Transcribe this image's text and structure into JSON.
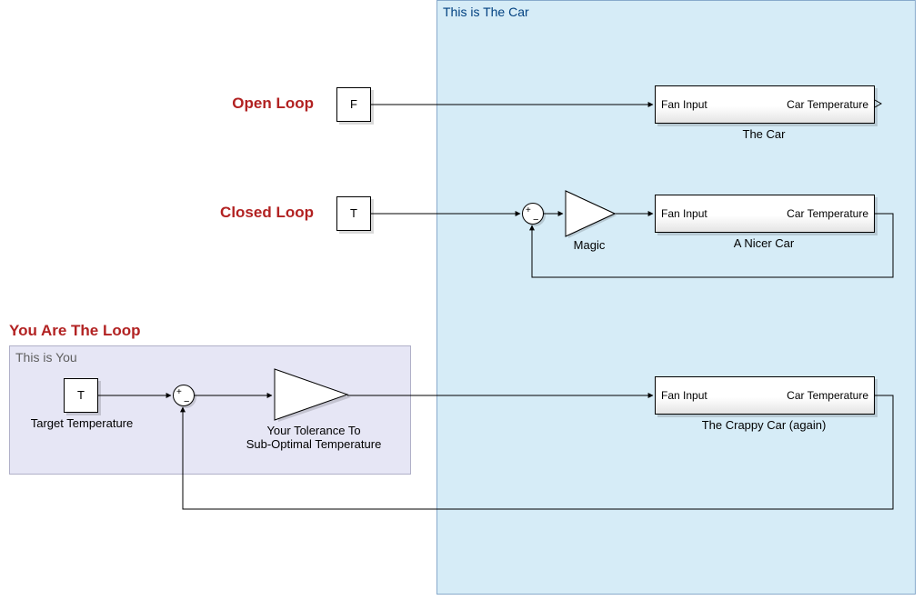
{
  "areas": {
    "car": {
      "title": "This is The Car"
    },
    "you": {
      "title": "This is You"
    }
  },
  "sections": {
    "open_loop": "Open Loop",
    "closed_loop": "Closed Loop",
    "you_are_the_loop": "You Are The Loop"
  },
  "blocks": {
    "const_F": {
      "text": "F"
    },
    "const_T1": {
      "text": "T"
    },
    "const_T2": {
      "text": "T",
      "label": "Target Temperature"
    },
    "gain_magic": {
      "label": "Magic"
    },
    "gain_tolerance": {
      "label_line1": "Your Tolerance To",
      "label_line2": "Sub-Optimal Temperature"
    },
    "sub_car": {
      "in": "Fan Input",
      "out": "Car Temperature",
      "label": "The Car"
    },
    "sub_nicer": {
      "in": "Fan Input",
      "out": "Car Temperature",
      "label": "A Nicer Car"
    },
    "sub_crappy": {
      "in": "Fan Input",
      "out": "Car Temperature",
      "label": "The Crappy Car (again)"
    }
  }
}
